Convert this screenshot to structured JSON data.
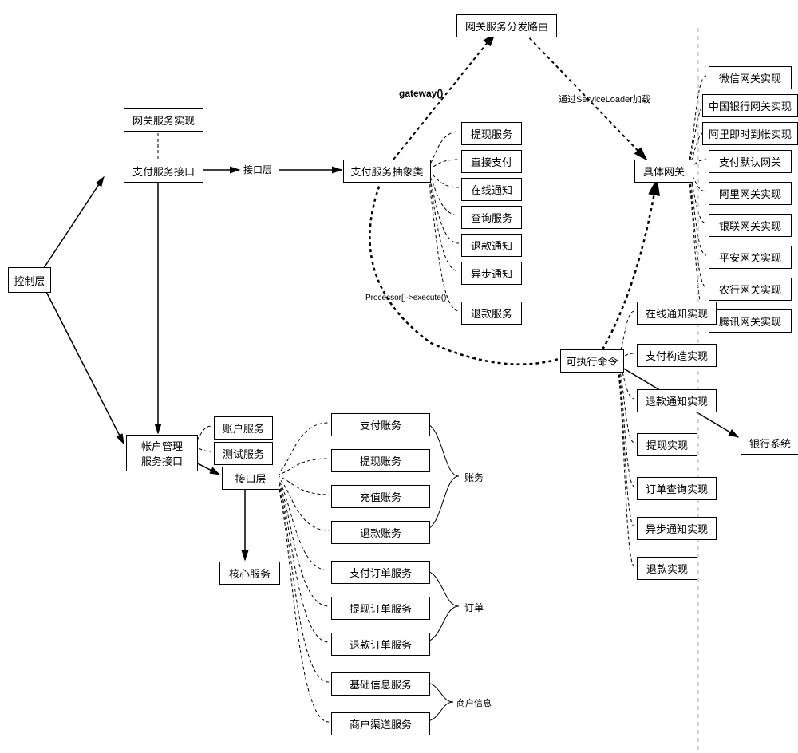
{
  "nodes": {
    "gateway_dispatch": "网关服务分发路由",
    "gateway_impl": "网关服务实现",
    "pay_service_if": "支付服务接口",
    "control_layer": "控制层",
    "interface_layer1": "接口层",
    "pay_abstract": "支付服务抽象类",
    "withdraw_svc": "提现服务",
    "direct_pay": "直接支付",
    "online_notify": "在线通知",
    "query_svc": "查询服务",
    "refund_notify": "退款通知",
    "async_notify": "异步通知",
    "refund_svc": "退款服务",
    "concrete_gw": "具体网关",
    "gw_wechat": "微信网关实现",
    "gw_boc": "中国银行网关实现",
    "gw_ali_instant": "阿里即时到帐实现",
    "gw_paydefault": "支付默认网关",
    "gw_ali": "阿里网关实现",
    "gw_union": "银联网关实现",
    "gw_pingan": "平安网关实现",
    "gw_abc": "农行网关实现",
    "gw_tencent": "腾讯网关实现",
    "executable_cmd": "可执行命令",
    "exec_online_notify": "在线通知实现",
    "exec_pay_build": "支付构造实现",
    "exec_refund_notify": "退款通知实现",
    "exec_withdraw": "提现实现",
    "exec_order_query": "订单查询实现",
    "exec_async_notify": "异步通知实现",
    "exec_refund": "退款实现",
    "bank_system": "银行系统",
    "acct_mgmt_if": "帐户管理\n服务接口",
    "acct_svc": "账户服务",
    "test_svc": "测试服务",
    "interface_layer2": "接口层",
    "core_svc": "核心服务",
    "pay_acct": "支付账务",
    "withdraw_acct": "提现账务",
    "recharge_acct": "充值账务",
    "refund_acct": "退款账务",
    "pay_order_svc": "支付订单服务",
    "withdraw_order_svc": "提现订单服务",
    "refund_order_svc": "退款订单服务",
    "basic_info_svc": "基础信息服务",
    "merchant_channel_svc": "商户渠道服务"
  },
  "edge_labels": {
    "gateway0": "gateway()",
    "svc_loader": "通过ServiceLoader加载",
    "processor": "Processor[]->execute()",
    "accounts": "账务",
    "orders": "订单",
    "merchant_info": "商户信息"
  }
}
